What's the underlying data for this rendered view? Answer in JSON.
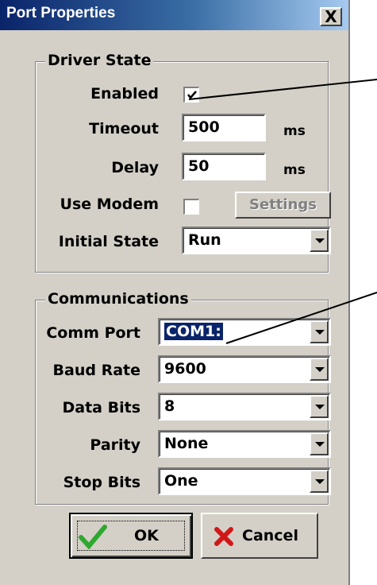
{
  "window": {
    "title": "Port Properties",
    "close_label": "X"
  },
  "driver_state": {
    "legend": "Driver State",
    "enabled_label": "Enabled",
    "enabled_checked": true,
    "timeout_label": "Timeout",
    "timeout_value": "500",
    "timeout_unit": "ms",
    "delay_label": "Delay",
    "delay_value": "50",
    "delay_unit": "ms",
    "use_modem_label": "Use Modem",
    "use_modem_checked": false,
    "settings_label": "Settings",
    "initial_state_label": "Initial State",
    "initial_state_value": "Run"
  },
  "communications": {
    "legend": "Communications",
    "comm_port_label": "Comm Port",
    "comm_port_value": "COM1:",
    "baud_rate_label": "Baud Rate",
    "baud_rate_value": "9600",
    "data_bits_label": "Data Bits",
    "data_bits_value": "8",
    "parity_label": "Parity",
    "parity_value": "None",
    "stop_bits_label": "Stop Bits",
    "stop_bits_value": "One"
  },
  "buttons": {
    "ok_label": "OK",
    "cancel_label": "Cancel"
  },
  "colors": {
    "title_bar": "#0a246a",
    "dialog_face": "#d4d0c8",
    "selection": "#0a246a",
    "ok_check": "#2fa82f",
    "cancel_x": "#d01818"
  }
}
